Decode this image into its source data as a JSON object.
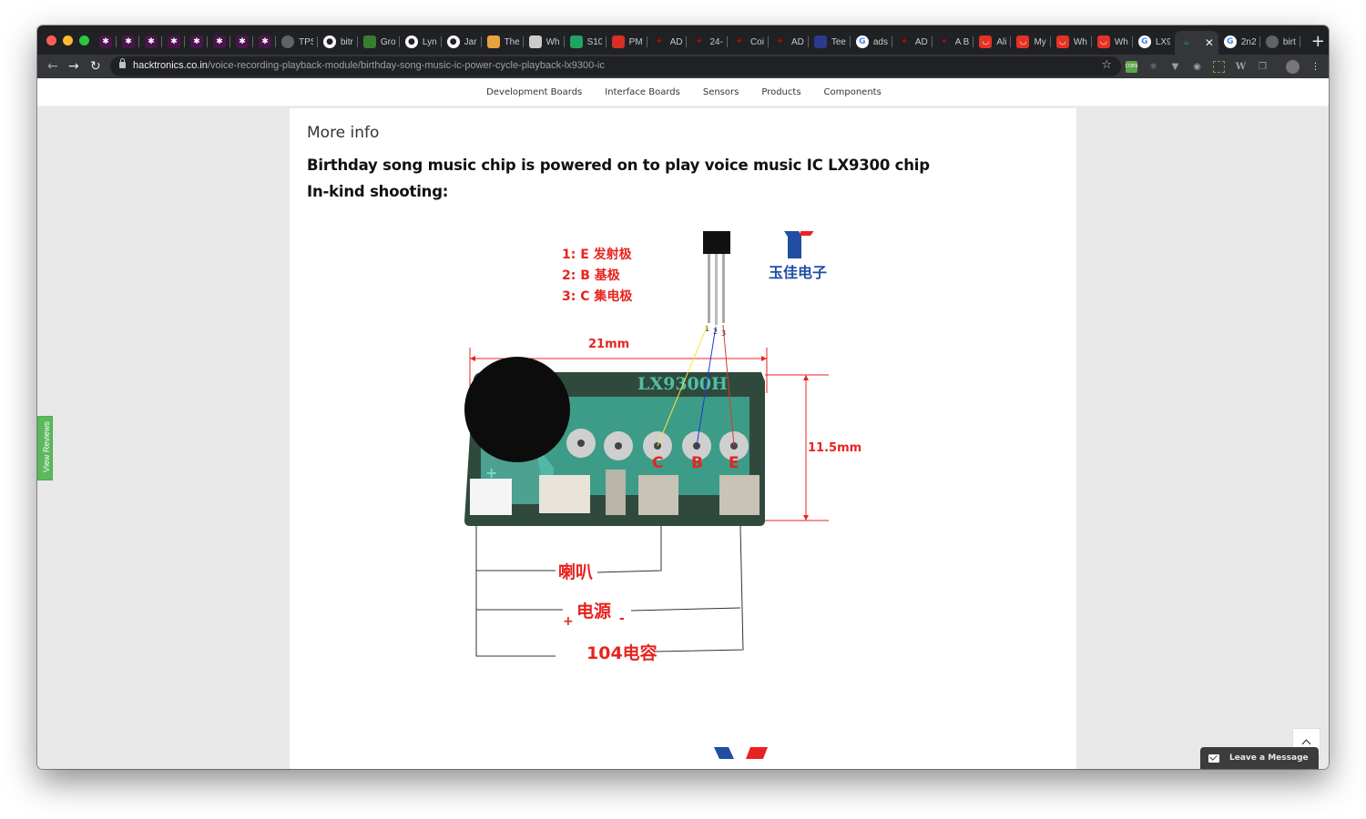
{
  "browser": {
    "tabs": [
      {
        "label": "",
        "icon": "slack-icon",
        "color": "#4a154b"
      },
      {
        "label": "",
        "icon": "slack-icon",
        "color": "#4a154b"
      },
      {
        "label": "",
        "icon": "slack-icon",
        "color": "#4a154b"
      },
      {
        "label": "",
        "icon": "slack-icon",
        "color": "#4a154b"
      },
      {
        "label": "",
        "icon": "slack-icon",
        "color": "#4a154b"
      },
      {
        "label": "",
        "icon": "slack-icon",
        "color": "#4a154b"
      },
      {
        "label": "",
        "icon": "slack-icon",
        "color": "#4a154b"
      },
      {
        "label": "",
        "icon": "slack-icon",
        "color": "#4a154b"
      },
      {
        "label": "TPS",
        "icon": "globe-icon",
        "color": "#5f6368"
      },
      {
        "label": "bitr",
        "icon": "github-icon",
        "color": "#ffffff"
      },
      {
        "label": "Gro",
        "icon": "leaf-icon",
        "color": "#3a7d32"
      },
      {
        "label": "Lyn",
        "icon": "github-icon",
        "color": "#ffffff"
      },
      {
        "label": "Jar",
        "icon": "github-icon",
        "color": "#ffffff"
      },
      {
        "label": "The",
        "icon": "globe-color-icon",
        "color": "#e8a33d"
      },
      {
        "label": "Wh",
        "icon": "pattern-icon",
        "color": "#cccccc"
      },
      {
        "label": "S10",
        "icon": "sheets-icon",
        "color": "#1fa463"
      },
      {
        "label": "PM",
        "icon": "k-icon",
        "color": "#d93025"
      },
      {
        "label": "AD",
        "icon": "ti-icon",
        "color": "#cc0000"
      },
      {
        "label": "24-",
        "icon": "ti-icon",
        "color": "#cc0000"
      },
      {
        "label": "Coi",
        "icon": "ti-icon",
        "color": "#cc0000"
      },
      {
        "label": "AD",
        "icon": "ti-icon",
        "color": "#cc0000"
      },
      {
        "label": "Tee",
        "icon": "pjrc-icon",
        "color": "#2a3b8f"
      },
      {
        "label": "ads",
        "icon": "google-icon",
        "color": "#ffffff"
      },
      {
        "label": "AD",
        "icon": "ti-icon",
        "color": "#cc0000"
      },
      {
        "label": "A B",
        "icon": "ti-icon",
        "color": "#cc0000"
      },
      {
        "label": "Ali",
        "icon": "aliexpress-icon",
        "color": "#e43225"
      },
      {
        "label": "My",
        "icon": "aliexpress-icon",
        "color": "#e43225"
      },
      {
        "label": "Wh",
        "icon": "aliexpress-icon",
        "color": "#e43225"
      },
      {
        "label": "Wh",
        "icon": "aliexpress-icon",
        "color": "#e43225"
      },
      {
        "label": "LX9",
        "icon": "google-icon",
        "color": "#ffffff"
      },
      {
        "label": "",
        "icon": "hacktronics-icon",
        "color": "#1e8e7e",
        "active": true
      },
      {
        "label": "2n2",
        "icon": "google-icon",
        "color": "#ffffff"
      },
      {
        "label": "birt",
        "icon": "globe-icon",
        "color": "#5f6368"
      }
    ],
    "url_domain": "hacktronics.co.in",
    "url_path": "/voice-recording-playback-module/birthday-song-music-ic-power-cycle-playback-lx9300-ic",
    "extensions": [
      "cors-icon",
      "react-icon",
      "vue-icon",
      "film-icon",
      "screenshot-icon",
      "wikipedia-icon",
      "copy-icon",
      "avatar-icon",
      "menu-icon"
    ]
  },
  "site_nav": [
    "Development Boards",
    "Interface Boards",
    "Sensors",
    "Products",
    "Components"
  ],
  "content": {
    "section_title": "More info",
    "headline1": "Birthday song music chip is powered on to play voice music IC LX9300 chip",
    "headline2": "In-kind shooting:"
  },
  "diagram": {
    "pin_legend": [
      "1: E 发射极",
      "2: B 基极",
      "3: C 集电极"
    ],
    "brand_text": "玉佳电子",
    "width_label": "21mm",
    "height_label": "11.5mm",
    "chip_label": "LX9300H",
    "pin_letters": [
      "C",
      "B",
      "E"
    ],
    "lead_numbers": [
      "1",
      "2",
      "3"
    ],
    "plus_mark": "+",
    "connections": [
      "喇叭",
      "电源",
      "104电容"
    ],
    "power_plus": "+",
    "power_minus": "-"
  },
  "widgets": {
    "review_tab": "View Reviews",
    "scroll_top": "^",
    "leave_message": "Leave a Message"
  },
  "colors": {
    "annotation_red": "#e8231f",
    "brand_blue": "#1f4ea3",
    "review_green": "#5cb85c",
    "pcb_green": "#3fa58f"
  }
}
